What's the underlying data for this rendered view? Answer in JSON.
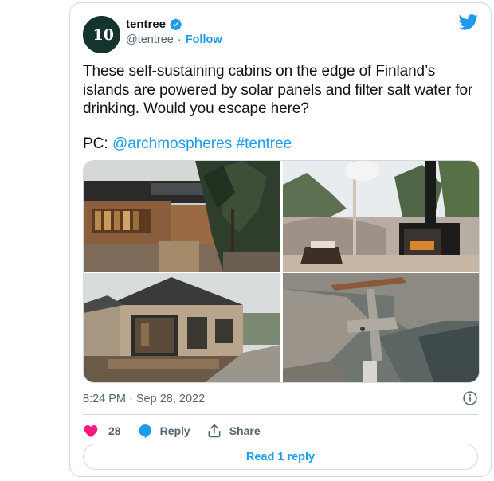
{
  "tweet": {
    "author": {
      "display_name": "tentree",
      "handle": "@tentree",
      "separator": "·",
      "follow_label": "Follow",
      "avatar_text": "10",
      "verified_icon": "verified-badge-icon"
    },
    "text": "These self-sustaining cabins on the edge of Finland’s islands are powered by solar panels and filter salt water for drinking. Would you escape here?",
    "credit": {
      "prefix": "PC:",
      "mention": "@archmospheres",
      "hashtag": "#tentree"
    },
    "photos": [
      {
        "subject": "wooden cabin exterior with pine trees and deck"
      },
      {
        "subject": "interior with black wood stove overlooking rocks and sea"
      },
      {
        "subject": "light wood cabin with large glass window on rocky shore"
      },
      {
        "subject": "aerial view of wooden walkway over rocks and water"
      }
    ],
    "timestamp": "8:24 PM · Sep 28, 2022",
    "actions": {
      "like_count": "28",
      "reply_label": "Reply",
      "share_label": "Share"
    },
    "read_replies_label": "Read 1 reply"
  },
  "colors": {
    "accent": "#1d9bf0",
    "like": "#f91880",
    "text": "#0f1419",
    "muted": "#536471",
    "border": "#cfd9de",
    "avatar_bg": "#16342f"
  }
}
